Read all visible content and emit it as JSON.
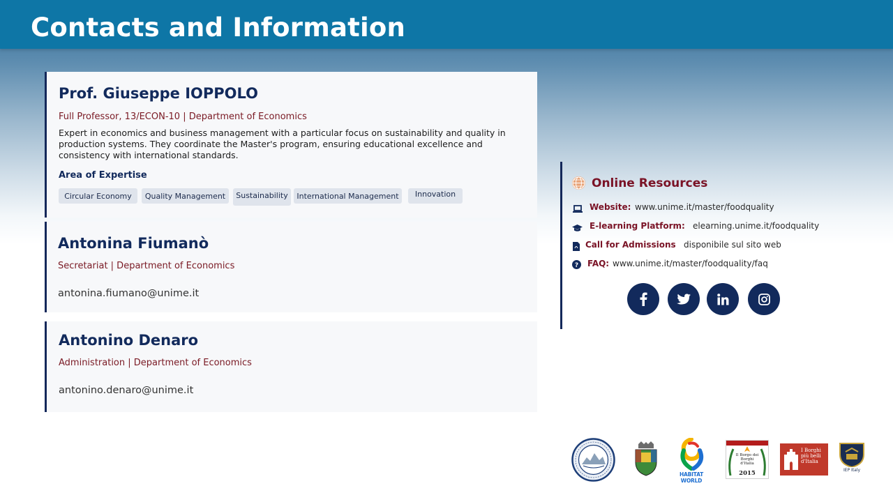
{
  "header": {
    "title": "Contacts and Information"
  },
  "contacts": [
    {
      "name": "Prof. Giuseppe IOPPOLO",
      "role": "Full Professor, 13/ECON-10 | Department of Economics",
      "description": "Expert in economics and business management with a particular focus on sustainability and quality in production systems. They coordinate the Master's program, ensuring educational excellence and consistency with international standards.",
      "expertise_title": "Area of Expertise",
      "expertise": [
        "Circular Economy",
        "Quality Management",
        "Sustainability",
        "International Management",
        "Innovation"
      ]
    },
    {
      "name": "Antonina Fiumanò",
      "role": "Secretariat | Department of Economics",
      "email": "antonina.fiumano@unime.it"
    },
    {
      "name": "Antonino Denaro",
      "role": "Administration | Department of Economics",
      "email": "antonino.denaro@unime.it"
    }
  ],
  "resources": {
    "title": "Online Resources",
    "items": [
      {
        "icon": "laptop-icon",
        "label": "Website:",
        "value": "www.unime.it/master/foodquality"
      },
      {
        "icon": "graduation-cap-icon",
        "label": "E-learning Platform:",
        "value": "elearning.unime.it/foodquality"
      },
      {
        "icon": "pdf-file-icon",
        "label": "Call for Admissions",
        "value": "disponibile sul sito web"
      },
      {
        "icon": "question-circle-icon",
        "label": "FAQ:",
        "value": "www.unime.it/master/foodquality/faq"
      }
    ],
    "social": [
      "facebook-icon",
      "twitter-icon",
      "linkedin-icon",
      "instagram-icon"
    ]
  },
  "logos": {
    "habitat_world": "HABITAT WORLD",
    "borgo": "Il Borgo dei Borghi d'Italia",
    "borgo_year": "2015",
    "borghi": "I Borghi più belli d'Italia",
    "iep": "IEP Italy"
  },
  "colors": {
    "header": "#0e76a6",
    "navy": "#122a5c",
    "accent": "#7a1326",
    "tag_bg": "#dfe4ec"
  }
}
